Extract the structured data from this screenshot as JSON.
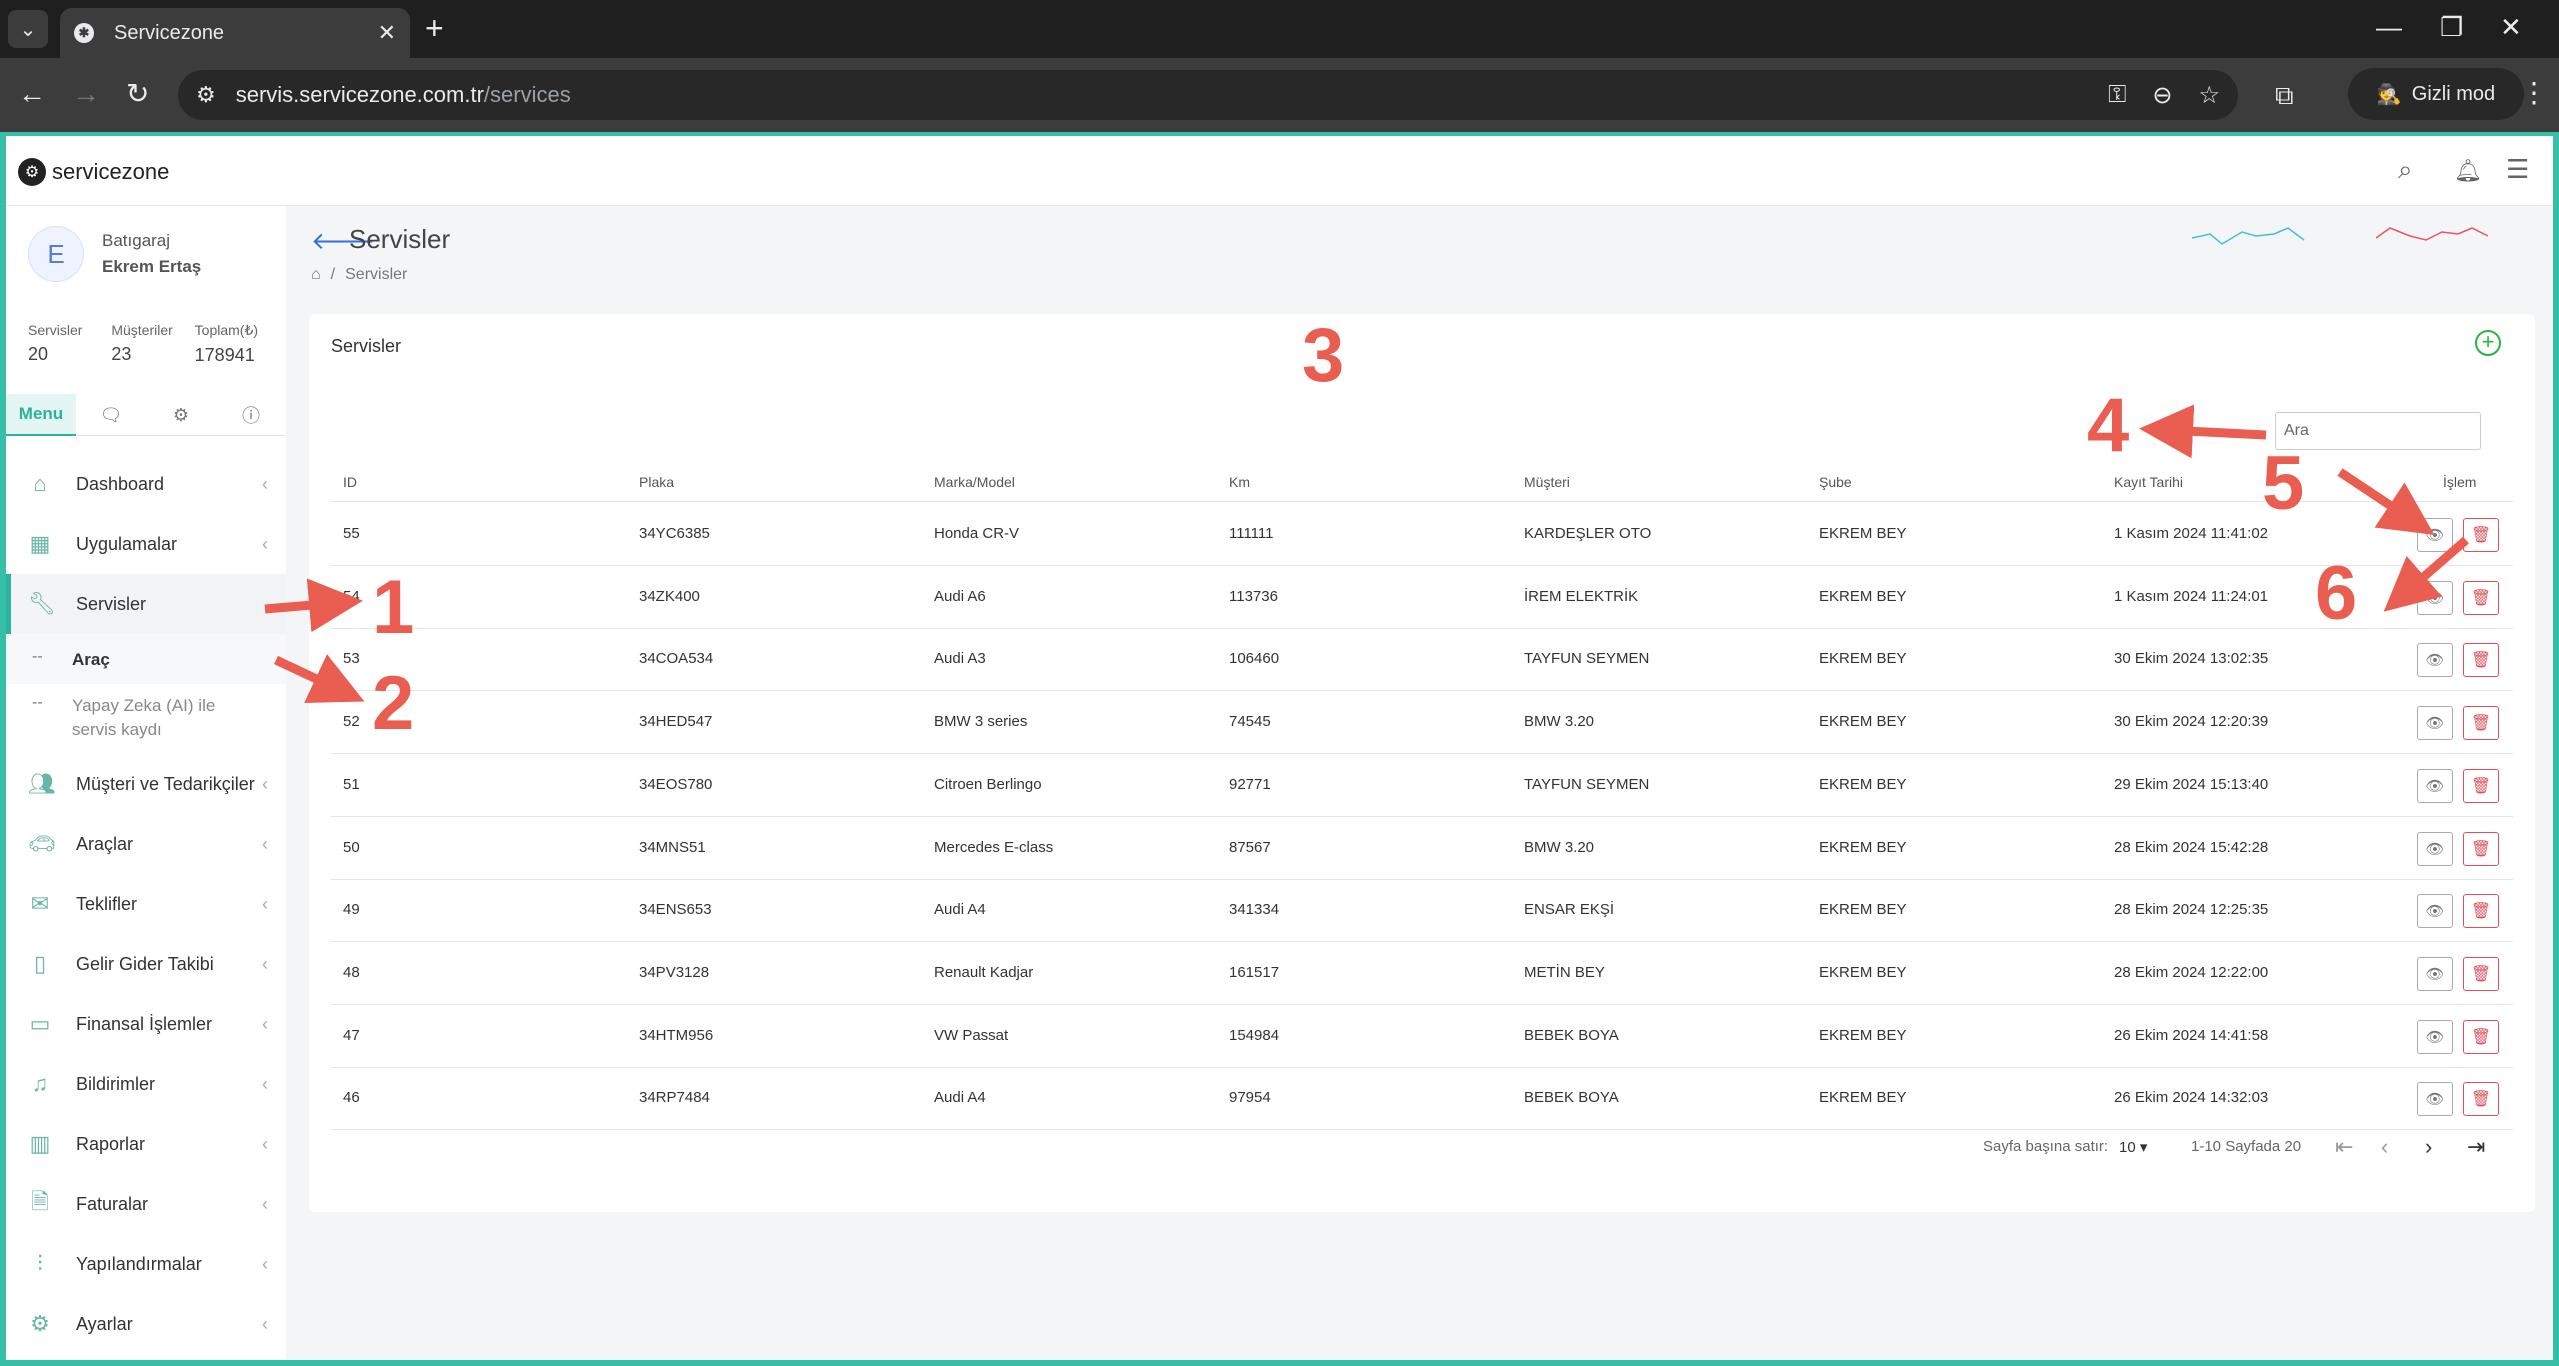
{
  "browser": {
    "tab_title": "Servicezone",
    "url_host": "servis.servicezone.com.tr",
    "url_path": "/services",
    "incognito_label": "Gizli mod"
  },
  "app": {
    "brand": "servicezone",
    "accent_color": "#2bb39a"
  },
  "user": {
    "initial": "E",
    "org": "Batıgaraj",
    "name": "Ekrem Ertaş"
  },
  "stats": [
    {
      "label": "Servisler",
      "value": "20"
    },
    {
      "label": "Müşteriler",
      "value": "23"
    },
    {
      "label": "Toplam(₺)",
      "value": "178941"
    }
  ],
  "sidebar_tabs": {
    "menu": "Menu"
  },
  "menu": [
    {
      "label": "Dashboard",
      "icon": "home-icon"
    },
    {
      "label": "Uygulamalar",
      "icon": "grid-icon"
    },
    {
      "label": "Servisler",
      "icon": "wrench-icon",
      "active": true
    },
    {
      "label": "Müşteri ve Tedarikçiler",
      "icon": "users-icon"
    },
    {
      "label": "Araçlar",
      "icon": "car-icon"
    },
    {
      "label": "Teklifler",
      "icon": "mail-icon"
    },
    {
      "label": "Gelir Gider Takibi",
      "icon": "book-icon"
    },
    {
      "label": "Finansal İşlemler",
      "icon": "wallet-icon"
    },
    {
      "label": "Bildirimler",
      "icon": "bell-icon"
    },
    {
      "label": "Raporlar",
      "icon": "chart-icon"
    },
    {
      "label": "Faturalar",
      "icon": "file-icon"
    },
    {
      "label": "Yapılandırmalar",
      "icon": "sliders-icon"
    },
    {
      "label": "Ayarlar",
      "icon": "gear-icon"
    }
  ],
  "submenu": [
    {
      "dash": "--",
      "label": "Araç",
      "active": true
    },
    {
      "dash": "--",
      "label": "Yapay Zeka (AI) ile servis kaydı"
    }
  ],
  "page": {
    "title": "Servisler",
    "breadcrumb": "Servisler",
    "card_title": "Servisler",
    "search_placeholder": "Ara"
  },
  "table": {
    "headers": [
      "ID",
      "Plaka",
      "Marka/Model",
      "Km",
      "Müşteri",
      "Şube",
      "Kayıt Tarihi",
      "İşlem"
    ],
    "rows": [
      [
        "55",
        "34YC6385",
        "Honda CR-V",
        "111111",
        "KARDEŞLER OTO",
        "EKREM BEY",
        "1 Kasım 2024 11:41:02"
      ],
      [
        "54",
        "34ZK400",
        "Audi A6",
        "113736",
        "İREM ELEKTRİK",
        "EKREM BEY",
        "1 Kasım 2024 11:24:01"
      ],
      [
        "53",
        "34COA534",
        "Audi A3",
        "106460",
        "TAYFUN SEYMEN",
        "EKREM BEY",
        "30 Ekim 2024 13:02:35"
      ],
      [
        "52",
        "34HED547",
        "BMW 3 series",
        "74545",
        "BMW 3.20",
        "EKREM BEY",
        "30 Ekim 2024 12:20:39"
      ],
      [
        "51",
        "34EOS780",
        "Citroen Berlingo",
        "92771",
        "TAYFUN SEYMEN",
        "EKREM BEY",
        "29 Ekim 2024 15:13:40"
      ],
      [
        "50",
        "34MNS51",
        "Mercedes E-class",
        "87567",
        "BMW 3.20",
        "EKREM BEY",
        "28 Ekim 2024 15:42:28"
      ],
      [
        "49",
        "34ENS653",
        "Audi A4",
        "341334",
        "ENSAR EKŞİ",
        "EKREM BEY",
        "28 Ekim 2024 12:25:35"
      ],
      [
        "48",
        "34PV3128",
        "Renault Kadjar",
        "161517",
        "METİN BEY",
        "EKREM BEY",
        "28 Ekim 2024 12:22:00"
      ],
      [
        "47",
        "34HTM956",
        "VW Passat",
        "154984",
        "BEBEK BOYA",
        "EKREM BEY",
        "26 Ekim 2024 14:41:58"
      ],
      [
        "46",
        "34RP7484",
        "Audi A4",
        "97954",
        "BEBEK BOYA",
        "EKREM BEY",
        "26 Ekim 2024 14:32:03"
      ]
    ]
  },
  "pagination": {
    "rows_per_page_label": "Sayfa başına satır:",
    "rows_per_page": "10",
    "range": "1-10 Sayfada 20"
  },
  "annotations": [
    "1",
    "2",
    "3",
    "4",
    "5",
    "6"
  ],
  "annotation_color": "#ea5e52"
}
